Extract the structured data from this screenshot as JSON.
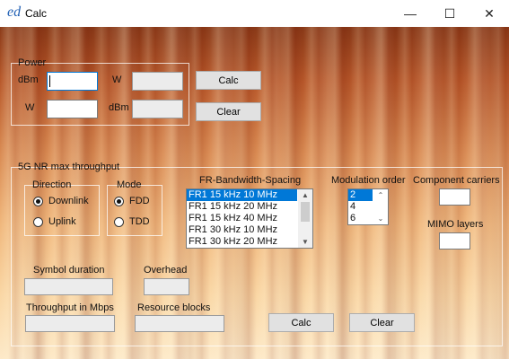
{
  "window": {
    "logo": "ed",
    "title": "Calc",
    "minimize": "—",
    "maximize": "☐",
    "close": "✕"
  },
  "power": {
    "legend": "Power",
    "dbm_label": "dBm",
    "w_label": "W",
    "w_label2": "W",
    "dbm_label2": "dBm",
    "dbm_value": "",
    "w_out": "",
    "w_value": "",
    "dbm_out": "",
    "calc_button": "Calc",
    "clear_button": "Clear"
  },
  "nr": {
    "legend": "5G NR max throughput",
    "direction": {
      "legend": "Direction",
      "options": [
        "Downlink",
        "Uplink"
      ],
      "selected": "Downlink"
    },
    "mode": {
      "legend": "Mode",
      "options": [
        "FDD",
        "TDD"
      ],
      "selected": "FDD"
    },
    "bandwidth": {
      "label": "FR-Bandwidth-Spacing",
      "items": [
        "FR1 15 kHz 10 MHz",
        "FR1 15 kHz 20 MHz",
        "FR1 15 kHz 40 MHz",
        "FR1 30 kHz 10 MHz",
        "FR1 30 kHz 20 MHz"
      ],
      "selected": "FR1 15 kHz 10 MHz"
    },
    "modulation": {
      "label": "Modulation order",
      "items": [
        "2",
        "4",
        "6"
      ],
      "selected": "2"
    },
    "component_carriers": {
      "label": "Component carriers",
      "value": ""
    },
    "mimo_layers": {
      "label": "MIMO layers",
      "value": ""
    },
    "symbol_duration": {
      "label": "Symbol duration",
      "value": ""
    },
    "overhead": {
      "label": "Overhead",
      "value": ""
    },
    "throughput": {
      "label": "Throughput in Mbps",
      "value": ""
    },
    "resource_blocks": {
      "label": "Resource blocks",
      "value": ""
    },
    "calc_button": "Calc",
    "clear_button": "Clear"
  }
}
